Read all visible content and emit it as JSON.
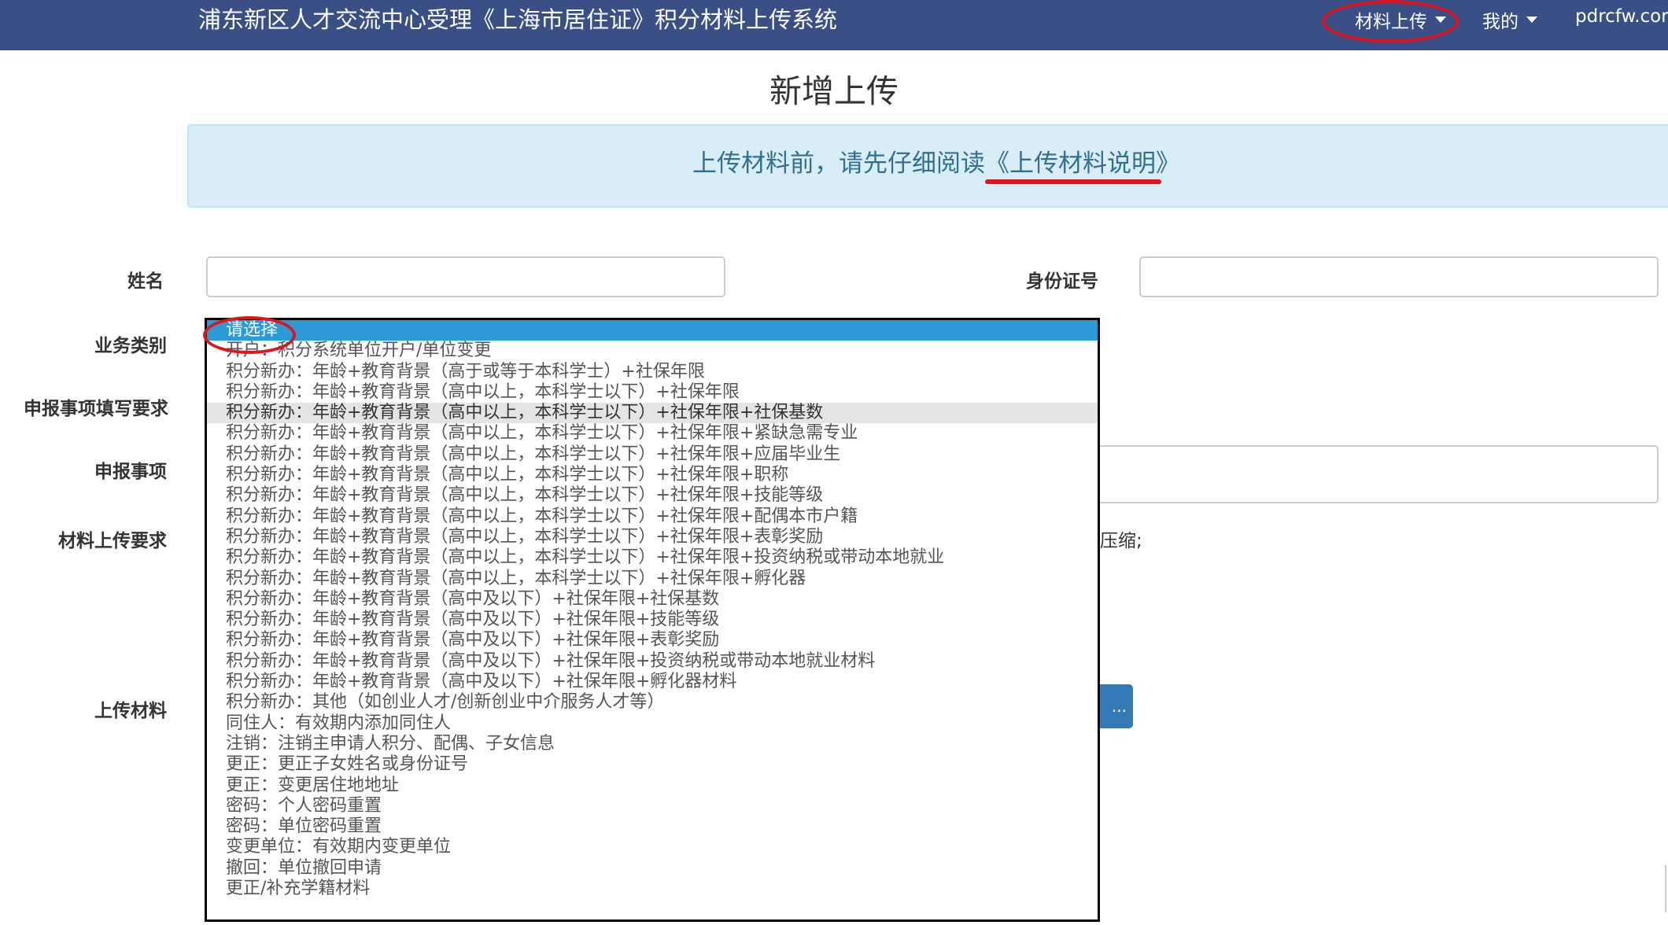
{
  "header": {
    "title": "浦东新区人才交流中心受理《上海市居住证》积分材料上传系统",
    "nav": {
      "upload_menu": "材料上传",
      "my_menu": "我的",
      "site": "pdrcfw.com"
    }
  },
  "page": {
    "heading": "新增上传",
    "notice_prefix": "上传材料前，请先仔细阅读",
    "notice_link": "《上传材料说明》"
  },
  "form": {
    "name_label": "姓名",
    "id_label": "身份证号",
    "business_type_label": "业务类别",
    "requirement_label": "申报事项填写要求",
    "item_label": "申报事项",
    "upload_req_label": "材料上传要求",
    "upload_label": "上传材料",
    "upload_req_visible_fragment": "压缩;",
    "upload_button_fragment": "..."
  },
  "dropdown": {
    "selected_index": 0,
    "hover_index": 4,
    "options": [
      "请选择",
      "开户：积分系统单位开户/单位变更",
      "积分新办：年龄+教育背景（高于或等于本科学士）+社保年限",
      "积分新办：年龄+教育背景（高中以上，本科学士以下）+社保年限",
      "积分新办：年龄+教育背景（高中以上，本科学士以下）+社保年限+社保基数",
      "积分新办：年龄+教育背景（高中以上，本科学士以下）+社保年限+紧缺急需专业",
      "积分新办：年龄+教育背景（高中以上，本科学士以下）+社保年限+应届毕业生",
      "积分新办：年龄+教育背景（高中以上，本科学士以下）+社保年限+职称",
      "积分新办：年龄+教育背景（高中以上，本科学士以下）+社保年限+技能等级",
      "积分新办：年龄+教育背景（高中以上，本科学士以下）+社保年限+配偶本市户籍",
      "积分新办：年龄+教育背景（高中以上，本科学士以下）+社保年限+表彰奖励",
      "积分新办：年龄+教育背景（高中以上，本科学士以下）+社保年限+投资纳税或带动本地就业",
      "积分新办：年龄+教育背景（高中以上，本科学士以下）+社保年限+孵化器",
      "积分新办：年龄+教育背景（高中及以下）+社保年限+社保基数",
      "积分新办：年龄+教育背景（高中及以下）+社保年限+技能等级",
      "积分新办：年龄+教育背景（高中及以下）+社保年限+表彰奖励",
      "积分新办：年龄+教育背景（高中及以下）+社保年限+投资纳税或带动本地就业材料",
      "积分新办：年龄+教育背景（高中及以下）+社保年限+孵化器材料",
      "积分新办：其他（如创业人才/创新创业中介服务人才等）",
      "同住人：有效期内添加同住人",
      "注销：注销主申请人积分、配偶、子女信息",
      "更正：更正子女姓名或身份证号",
      "更正：变更居住地地址",
      "密码：个人密码重置",
      "密码：单位密码重置",
      "变更单位：有效期内变更单位",
      "撤回：单位撤回申请",
      "更正/补充学籍材料"
    ]
  },
  "colors": {
    "navbar": "#3a4f86",
    "notice_bg": "#d9edf7",
    "notice_text": "#31708f",
    "selected_option": "#2b9ad5",
    "annotation_red": "#e0141e",
    "primary_button": "#337ab7"
  }
}
